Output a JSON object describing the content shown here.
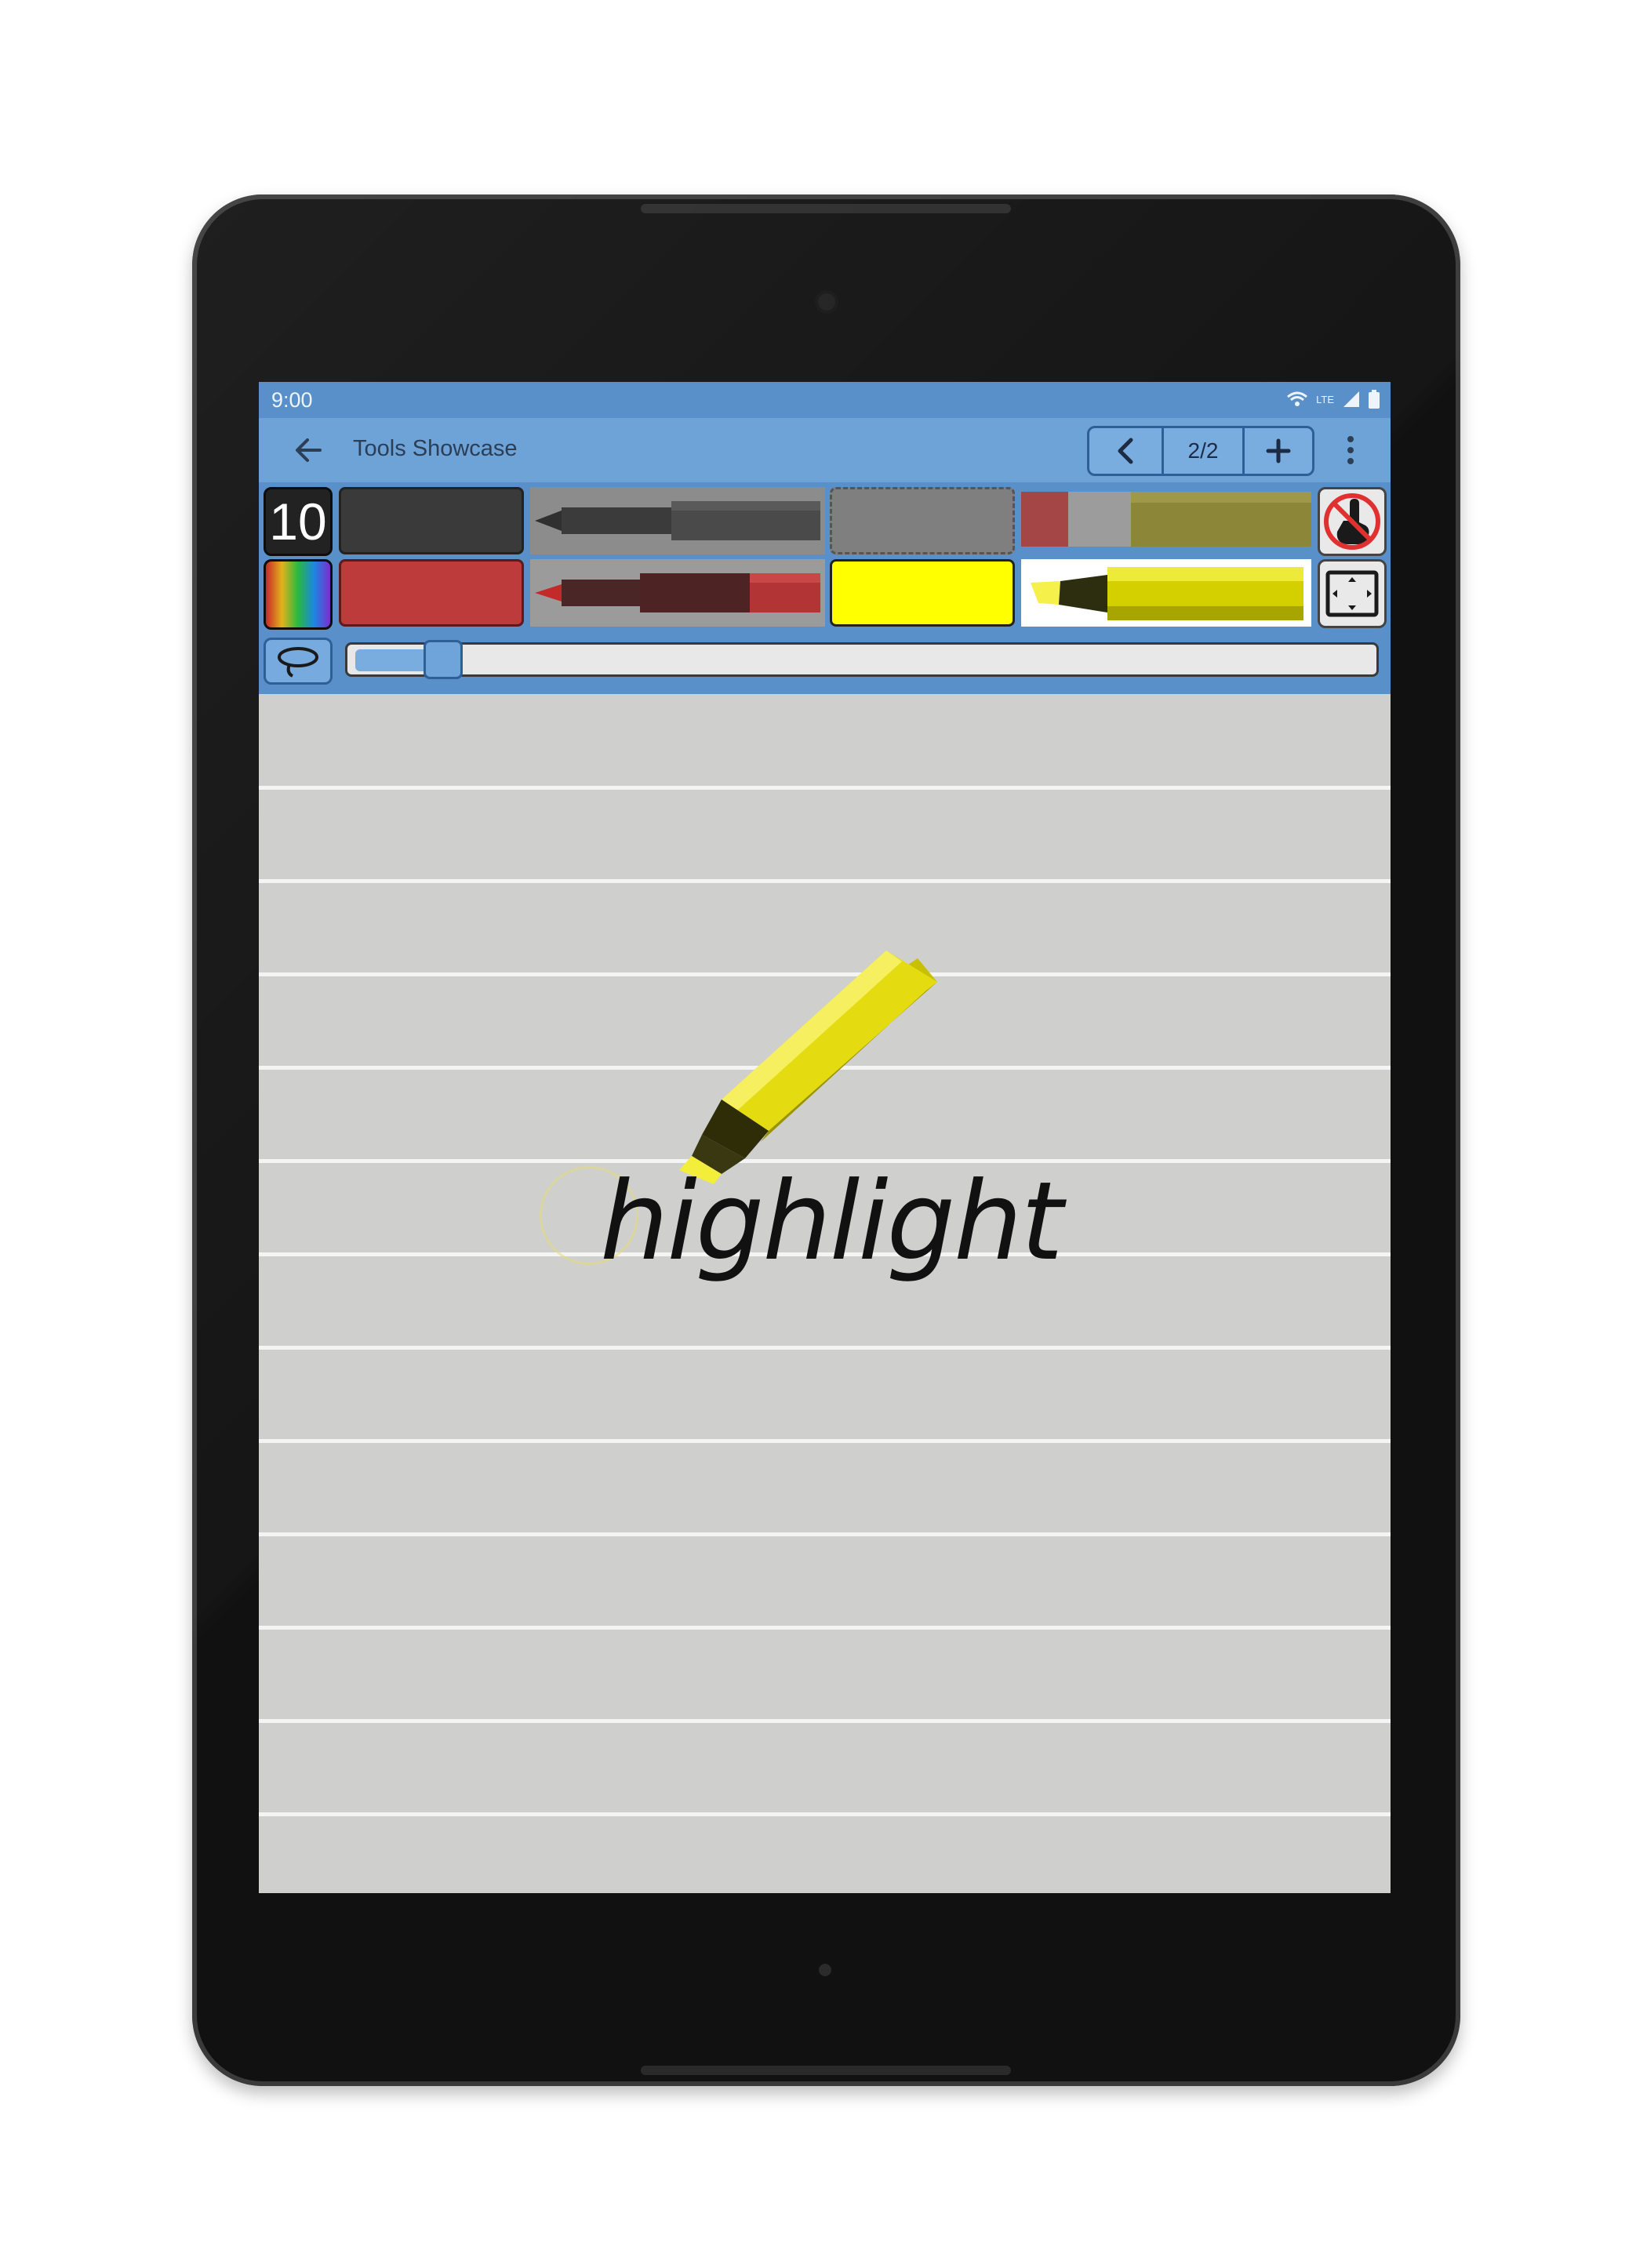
{
  "status_bar": {
    "time": "9:00",
    "network": "LTE"
  },
  "app_bar": {
    "title": "Tools Showcase",
    "page_indicator": "2/2"
  },
  "toolbar": {
    "size_value": "10",
    "colors": {
      "dark": "#3a3a3a",
      "red": "#bd3b3b",
      "gray": "#7f7f7f",
      "yellow": "#ffff00",
      "accent": "#5a90c9"
    }
  },
  "slider": {
    "position_fraction": 0.055
  },
  "canvas": {
    "text": "highlight"
  }
}
